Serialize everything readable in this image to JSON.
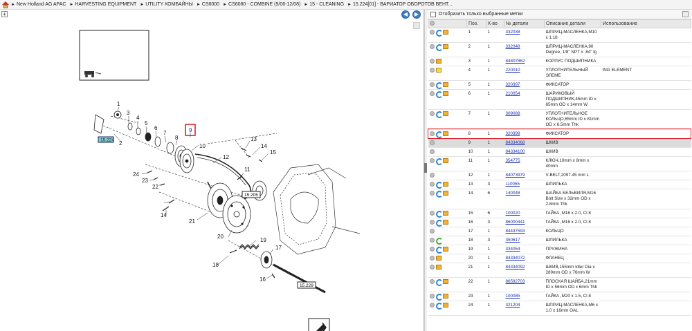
{
  "breadcrumb": [
    "New Holland AG APAC",
    "HARVESTING EQUIPMENT",
    "UTILITY КОМБАЙНЫ",
    "CS6000",
    "CS6080 - COMBINE (9/06-12/08)",
    "15 - CLEANING",
    "15.224[01] - ВАРИАТОР ОБОРОТОВ ВЕНТ..."
  ],
  "filter": {
    "label": "Отобразить только выбранные метки"
  },
  "table": {
    "headers": {
      "pos": "Поз.",
      "qty": "К-во",
      "partno": "№ детали",
      "desc": "Описание детали",
      "usage": "Использование"
    },
    "rows": [
      {
        "pos": "1",
        "qty": "1",
        "partno": "332038",
        "desc": "ШПРИЦ-МАСЛЕНКА,M10 x 1.18",
        "icons": [
          "info",
          "swap",
          "box"
        ]
      },
      {
        "pos": "2",
        "qty": "1",
        "partno": "332048",
        "desc": "ШПРИЦ-МАСЛЕНКА,90 Degree, 1/8\" NPT x .84\" lg",
        "icons": [
          "info",
          "swap",
          "box"
        ]
      },
      {
        "pos": "3",
        "qty": "1",
        "partno": "84807862",
        "desc": "КОРПУС ПОДШИПНИКА",
        "icons": [
          "info",
          "box"
        ]
      },
      {
        "pos": "4",
        "qty": "1",
        "partno": "220010",
        "desc": "УПЛОТНИТЕЛЬНЫЙ ЭЛЕМЕ",
        "usage": "ING ELEMENT",
        "icons": [
          "info",
          "chart"
        ]
      },
      {
        "pos": "5",
        "qty": "1",
        "partno": "320397",
        "desc": "ФИКСАТОР",
        "icons": [
          "info",
          "swap",
          "box"
        ]
      },
      {
        "pos": "6",
        "qty": "1",
        "partno": "210054",
        "desc": "ШАРИКОВЫЙ ПОДШИПНИК,45mm ID x 65mm OD x 14mm W",
        "icons": [
          "info",
          "swap",
          "box"
        ]
      },
      {
        "pos": "7",
        "qty": "1",
        "partno": "309088",
        "desc": "УПЛОТНИТЕЛЬНОЕ КОЛЬЦО,65mm ID x 81mm OD x 6.5mm Thk",
        "icons": [
          "info",
          "swap",
          "box"
        ]
      },
      {
        "pos": "8",
        "qty": "1",
        "partno": "320399",
        "desc": "ФИКСАТОР",
        "icons": [
          "info",
          "swap",
          "box"
        ]
      },
      {
        "pos": "9",
        "qty": "1",
        "partno": "84334068",
        "desc": "ШКИВ",
        "icons": [
          "info"
        ],
        "highlight": true
      },
      {
        "pos": "10",
        "qty": "1",
        "partno": "84334100",
        "desc": "ШКИВ",
        "icons": [
          "info"
        ]
      },
      {
        "pos": "11",
        "qty": "1",
        "partno": "354775",
        "desc": "КЛЮЧ,10mm x 8mm x 40mm",
        "icons": [
          "info",
          "swap",
          "box"
        ]
      },
      {
        "pos": "12",
        "qty": "1",
        "partno": "84073979",
        "desc": "V-BELT,2097.45 mm L",
        "icons": [
          "info"
        ]
      },
      {
        "pos": "13",
        "qty": "3",
        "partno": "110055",
        "desc": "ШПИЛЬКА",
        "icons": [
          "info",
          "swap",
          "box"
        ]
      },
      {
        "pos": "14",
        "qty": "6",
        "partno": "140048",
        "desc": "ШАЙБА БЕЛЬВИЛЯ,M16 Bolt Size x 32mm OD x 2.8mm Thk",
        "icons": [
          "info",
          "swap",
          "box"
        ]
      },
      {
        "pos": "15",
        "qty": "6",
        "partno": "100020",
        "desc": "ГАЙКА ,M16 x 2.0, Cl 8",
        "icons": [
          "info",
          "swap",
          "box"
        ]
      },
      {
        "pos": "16",
        "qty": "3",
        "partno": "86000441",
        "desc": "ГАЙКА ,M16 x 2.0, Cl 8",
        "icons": [
          "info",
          "swap",
          "box"
        ]
      },
      {
        "pos": "17",
        "qty": "1",
        "partno": "84437593",
        "desc": "КОЛЬЦО",
        "icons": [
          "info"
        ]
      },
      {
        "pos": "18",
        "qty": "3",
        "partno": "350617",
        "desc": "ШПИЛЬКА",
        "icons": [
          "info",
          "green"
        ]
      },
      {
        "pos": "19",
        "qty": "1",
        "partno": "334054",
        "desc": "ПРУЖИНА",
        "icons": [
          "info",
          "swap",
          "box"
        ]
      },
      {
        "pos": "20",
        "qty": "1",
        "partno": "84334072",
        "desc": "ФЛАНЕЦ",
        "icons": [
          "info",
          "box"
        ]
      },
      {
        "pos": "21",
        "qty": "1",
        "partno": "84334092",
        "desc": "ШКИВ,155mm Idler Dia x 289mm OD x 76mm W",
        "icons": [
          "info",
          "box"
        ]
      },
      {
        "pos": "22",
        "qty": "1",
        "partno": "86592703",
        "desc": "ПЛОСКАЯ ШАЙБА,21mm ID x 56mm OD x 6mm Thk",
        "icons": [
          "info",
          "swap",
          "box"
        ]
      },
      {
        "pos": "23",
        "qty": "1",
        "partno": "100085",
        "desc": "ГАЙКА ,M20 x 1.5, Cl 8",
        "icons": [
          "info",
          "swap",
          "box"
        ]
      },
      {
        "pos": "24",
        "qty": "1",
        "partno": "321204",
        "desc": "ШПРИЦ-МАСЛЕНКА,M6 x 1.0 x 16mm OAL",
        "icons": [
          "info",
          "swap",
          "box"
        ]
      }
    ]
  },
  "diagram": {
    "callouts": [
      "1",
      "2",
      "3",
      "4",
      "5",
      "6",
      "7",
      "8",
      "9",
      "10",
      "11",
      "12",
      "13",
      "14",
      "15",
      "16",
      "17",
      "18",
      "19",
      "20",
      "21",
      "22",
      "23",
      "24",
      "14"
    ],
    "refs": [
      "15.224",
      "15.205",
      "15.229"
    ]
  }
}
